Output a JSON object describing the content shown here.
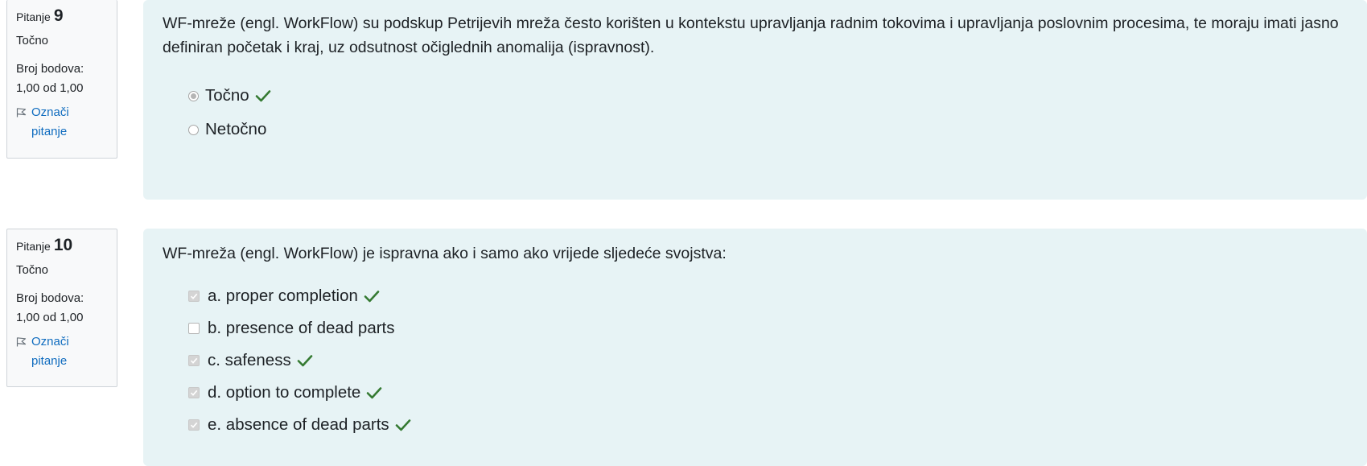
{
  "questions": [
    {
      "label": "Pitanje",
      "number": "9",
      "state": "Točno",
      "grade_label": "Broj bodova:",
      "grade_value": "1,00 od 1,00",
      "flag": "Označi pitanje",
      "text": "WF-mreže (engl. WorkFlow) su podskup Petrijevih mreža često korišten u kontekstu upravljanja radnim tokovima i upravljanja poslovnim procesima, te moraju imati jasno definiran početak i kraj, uz odsutnost očiglednih anomalija (ispravnost).",
      "answers": [
        {
          "label": "Točno",
          "selected": true,
          "correct": true
        },
        {
          "label": "Netočno",
          "selected": false,
          "correct": false
        }
      ]
    },
    {
      "label": "Pitanje",
      "number": "10",
      "state": "Točno",
      "grade_label": "Broj bodova:",
      "grade_value": "1,00 od 1,00",
      "flag": "Označi pitanje",
      "text": "WF-mreža (engl. WorkFlow)  je ispravna ako i samo ako vrijede sljedeće svojstva:",
      "answers": [
        {
          "label": "a. proper completion",
          "selected": true,
          "correct": true
        },
        {
          "label": "b. presence of dead parts",
          "selected": false,
          "correct": false
        },
        {
          "label": "c. safeness",
          "selected": true,
          "correct": true
        },
        {
          "label": "d. option to complete",
          "selected": true,
          "correct": true
        },
        {
          "label": "e. absence of dead parts",
          "selected": true,
          "correct": true
        }
      ]
    }
  ],
  "colors": {
    "correct_check": "#357a32",
    "link": "#0f6cbf",
    "panel": "#e7f3f5"
  },
  "icons": {
    "flag": "flag-icon",
    "correct": "check-icon"
  }
}
